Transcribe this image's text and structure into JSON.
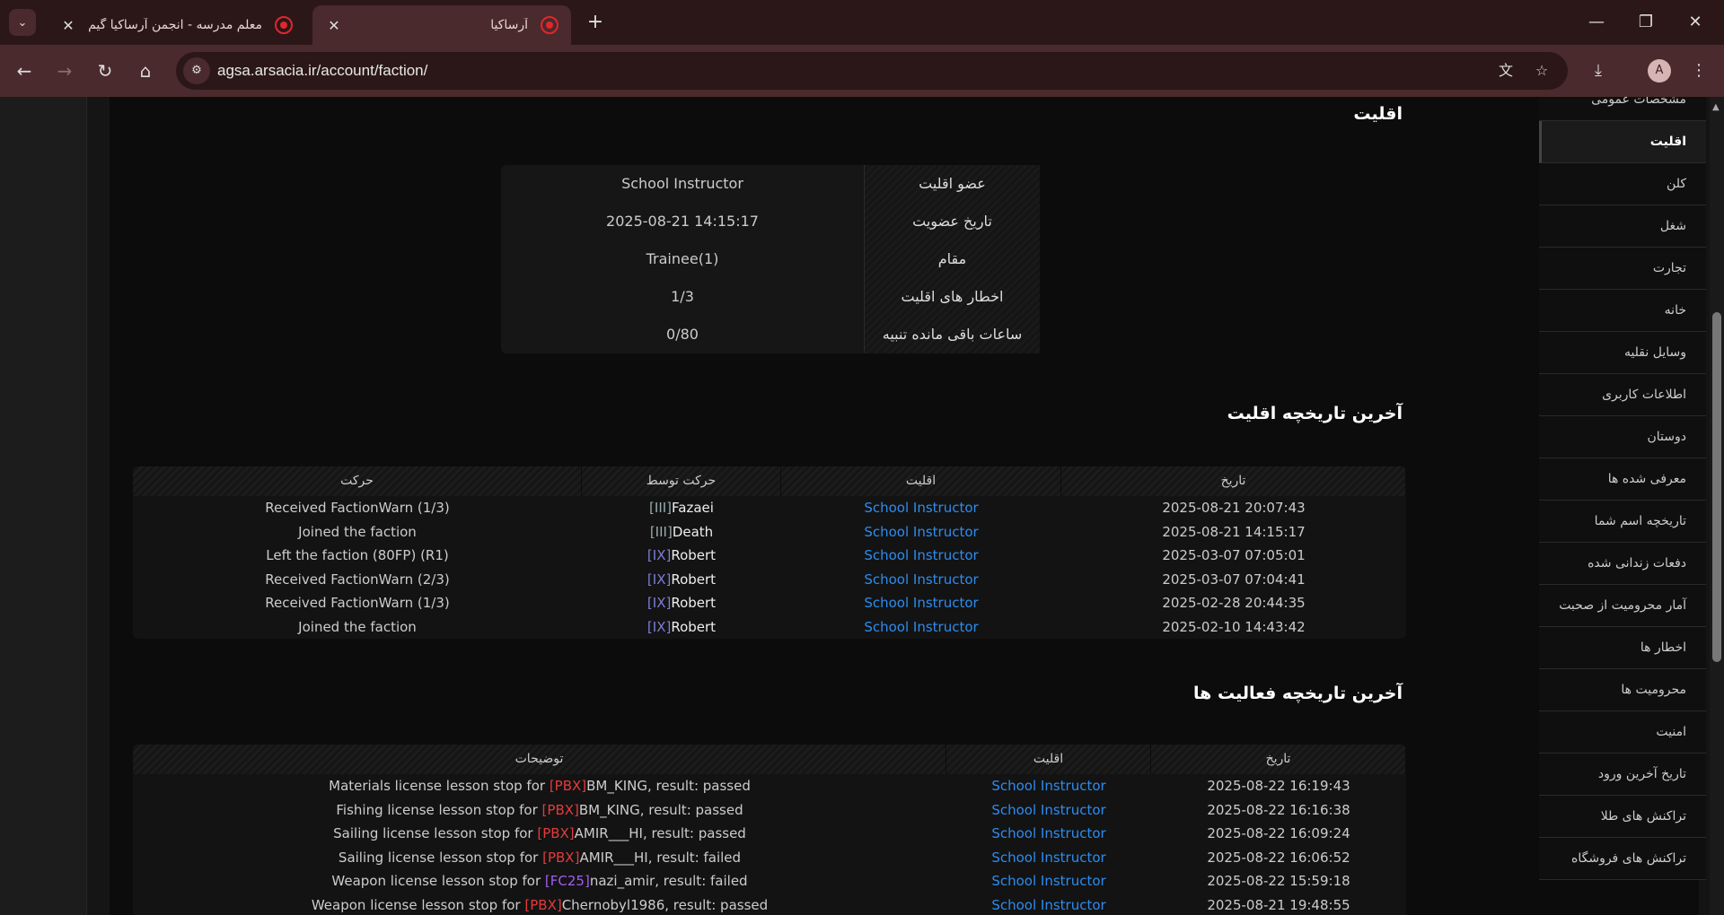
{
  "browser": {
    "tabs": [
      {
        "title": "معلم مدرسه - انجمن آرساکیا گیم",
        "active": false
      },
      {
        "title": "آرساکیا",
        "active": true
      }
    ],
    "url": "agsa.arsacia.ir/account/faction/",
    "avatar_letter": "A"
  },
  "sidebar": {
    "items": [
      {
        "label": "مشخصات عمومی",
        "active": false
      },
      {
        "label": "اقلیت",
        "active": true
      },
      {
        "label": "کلن",
        "active": false
      },
      {
        "label": "شغل",
        "active": false
      },
      {
        "label": "تجارت",
        "active": false
      },
      {
        "label": "خانه",
        "active": false
      },
      {
        "label": "وسایل نقلیه",
        "active": false
      },
      {
        "label": "اطلاعات کاربری",
        "active": false
      },
      {
        "label": "دوستان",
        "active": false
      },
      {
        "label": "معرفی شده ها",
        "active": false
      },
      {
        "label": "تاریخچه اسم شما",
        "active": false
      },
      {
        "label": "دفعات زندانی شده",
        "active": false
      },
      {
        "label": "آمار محرومیت از صحبت",
        "active": false
      },
      {
        "label": "اخطار ها",
        "active": false
      },
      {
        "label": "محرومیت ها",
        "active": false
      },
      {
        "label": "امنیت",
        "active": false
      },
      {
        "label": "تاریخ آخرین ورود",
        "active": false
      },
      {
        "label": "تراکنش های طلا",
        "active": false
      },
      {
        "label": "تراکنش های فروشگاه",
        "active": false
      }
    ]
  },
  "faction": {
    "title": "اقلیت",
    "info": [
      {
        "label": "عضو اقلیت",
        "value": "School Instructor"
      },
      {
        "label": "تاریخ عضویت",
        "value": "2025-08-21 14:15:17"
      },
      {
        "label": "مقام",
        "value": "Trainee(1)"
      },
      {
        "label": "اخطار های اقلیت",
        "value": "1/3"
      },
      {
        "label": "ساعات باقی مانده تنبیه",
        "value": "0/80"
      }
    ]
  },
  "history": {
    "title": "آخرین تاریخچه اقلیت",
    "headers": {
      "date": "تاریخ",
      "faction": "اقلیت",
      "by": "حرکت توسط",
      "action": "حرکت"
    },
    "rows": [
      {
        "date": "2025-08-21 20:07:43",
        "faction": "School Instructor",
        "tag": "[III]",
        "by": "Fazaei",
        "action": "Received FactionWarn (1/3)"
      },
      {
        "date": "2025-08-21 14:15:17",
        "faction": "School Instructor",
        "tag": "[III]",
        "by": "Death",
        "action": "Joined the faction"
      },
      {
        "date": "2025-03-07 07:05:01",
        "faction": "School Instructor",
        "tag": "[IX]",
        "by": "Robert",
        "action": "Left the faction (80FP) (R1)"
      },
      {
        "date": "2025-03-07 07:04:41",
        "faction": "School Instructor",
        "tag": "[IX]",
        "by": "Robert",
        "action": "Received FactionWarn (2/3)"
      },
      {
        "date": "2025-02-28 20:44:35",
        "faction": "School Instructor",
        "tag": "[IX]",
        "by": "Robert",
        "action": "Received FactionWarn (1/3)"
      },
      {
        "date": "2025-02-10 14:43:42",
        "faction": "School Instructor",
        "tag": "[IX]",
        "by": "Robert",
        "action": "Joined the faction"
      }
    ]
  },
  "activity": {
    "title": "آخرین تاریخچه فعالیت ها",
    "headers": {
      "date": "تاریخ",
      "faction": "اقلیت",
      "desc": "توضیحات"
    },
    "rows": [
      {
        "date": "2025-08-22 16:19:43",
        "faction": "School Instructor",
        "pre": "Materials license lesson stop for ",
        "tag": "[PBX]",
        "tag_color": "red",
        "name": "BM_KING",
        "post": ", result: passed"
      },
      {
        "date": "2025-08-22 16:16:38",
        "faction": "School Instructor",
        "pre": "Fishing license lesson stop for ",
        "tag": "[PBX]",
        "tag_color": "red",
        "name": "BM_KING",
        "post": ", result: passed"
      },
      {
        "date": "2025-08-22 16:09:24",
        "faction": "School Instructor",
        "pre": "Sailing license lesson stop for ",
        "tag": "[PBX]",
        "tag_color": "red",
        "name": "AMIR___HI",
        "post": ", result: passed"
      },
      {
        "date": "2025-08-22 16:06:52",
        "faction": "School Instructor",
        "pre": "Sailing license lesson stop for ",
        "tag": "[PBX]",
        "tag_color": "red",
        "name": "AMIR___HI",
        "post": ", result: failed"
      },
      {
        "date": "2025-08-22 15:59:18",
        "faction": "School Instructor",
        "pre": "Weapon license lesson stop for ",
        "tag": "[FC25]",
        "tag_color": "purple",
        "name": "nazi_amir",
        "post": ", result: failed"
      },
      {
        "date": "2025-08-21 19:48:55",
        "faction": "School Instructor",
        "pre": "Weapon license lesson stop for ",
        "tag": "[PBX]",
        "tag_color": "red",
        "name": "Chernobyl1986",
        "post": ", result: passed"
      }
    ]
  }
}
